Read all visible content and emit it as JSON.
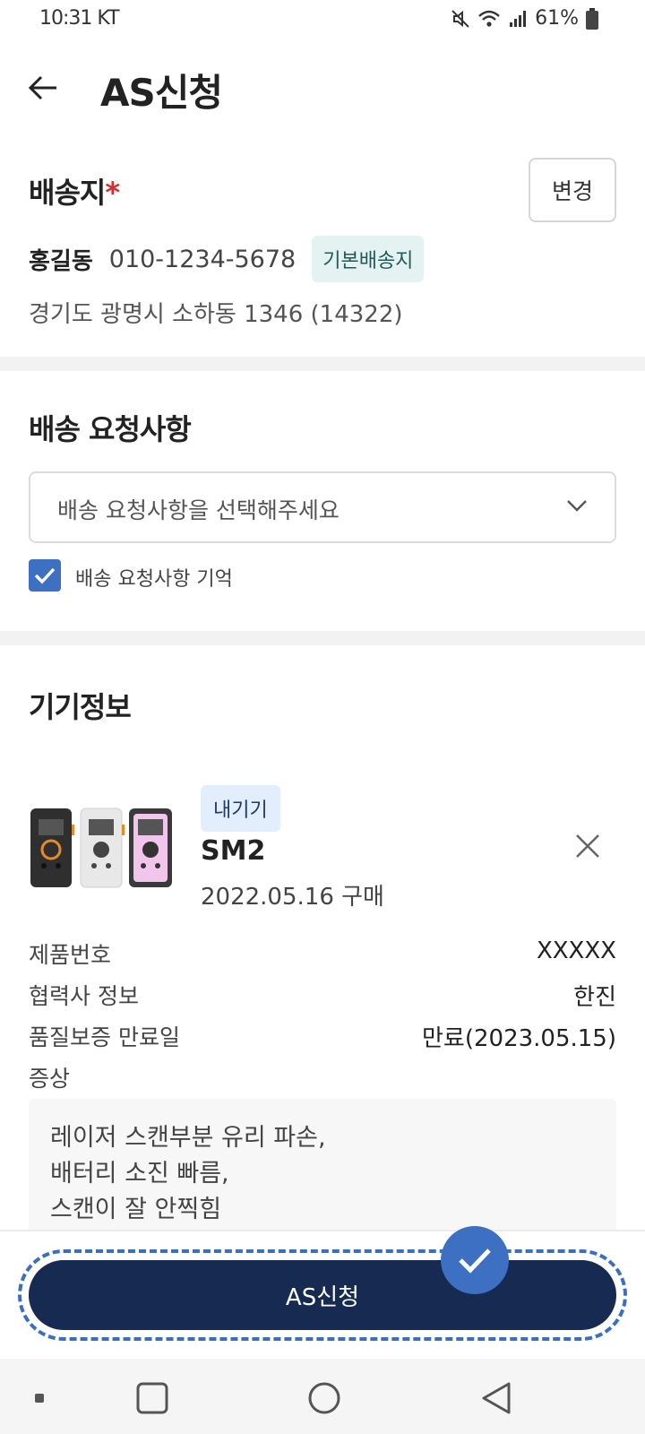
{
  "status_bar": {
    "time": "10:31 KT",
    "battery": "61%"
  },
  "header": {
    "title": "AS신청"
  },
  "shipping": {
    "title": "배송지",
    "required_mark": "*",
    "change_label": "변경",
    "name": "홍길동",
    "phone": "010-1234-5678",
    "badge": "기본배송지",
    "address": "경기도 광명시 소하동 1346 (14322)"
  },
  "request": {
    "title": "배송 요청사항",
    "select_placeholder": "배송 요청사항을 선택해주세요",
    "remember_label": "배송 요청사항 기억",
    "remember_checked": true
  },
  "device": {
    "title": "기기정보",
    "owner_badge": "내기기",
    "name": "SM2",
    "purchase": "2022.05.16 구매",
    "image_colors": [
      "#2f2f2f",
      "#e8e8e8",
      "#f2c6ec"
    ],
    "info": [
      {
        "label": "제품번호",
        "value": "XXXXX"
      },
      {
        "label": "협력사 정보",
        "value": "한진"
      },
      {
        "label": "품질보증 만료일",
        "value": "만료(2023.05.15)"
      }
    ],
    "symptom_label": "증상",
    "symptom_lines": [
      "레이저 스캔부분 유리 파손,",
      "배터리 소진 빠름,",
      "스캔이 잘 안찍힘"
    ]
  },
  "submit": {
    "label": "AS신청"
  },
  "colors": {
    "primary": "#172a52",
    "accent": "#3d6fc2",
    "required": "#d32f2f"
  },
  "nav": {
    "icons": [
      "recents-icon",
      "home-icon",
      "back-icon"
    ]
  }
}
